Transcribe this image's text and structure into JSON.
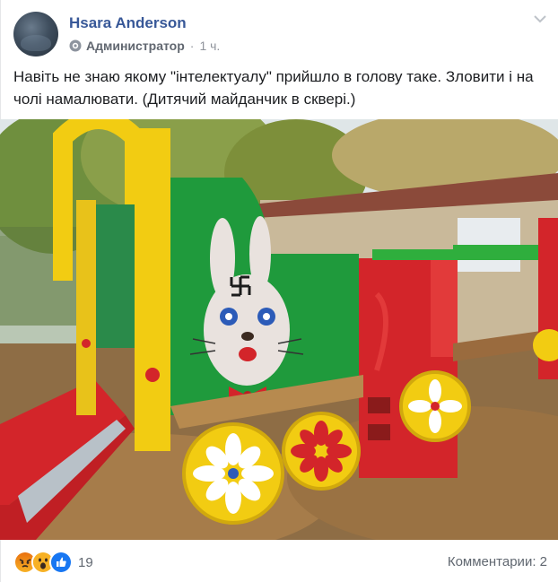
{
  "post": {
    "author": "Hsara Anderson",
    "role": "Администратор",
    "separator": "·",
    "time": "1 ч.",
    "text": "Навіть не знаю якому \"інтелектуалу\" прийшло в голову таке. Зловити і на чолі намалювати. (Дитячий майданчик в сквері.)"
  },
  "reactions": {
    "icons": [
      "angry-icon",
      "wow-icon",
      "like-icon"
    ],
    "count": "19"
  },
  "comments": {
    "label": "Комментарии: 2"
  },
  "colors": {
    "author": "#385898",
    "meta": "#616770",
    "text": "#1c1e21",
    "like": "#1877f2",
    "angry": "#e9710f",
    "wow": "#f7b125"
  }
}
